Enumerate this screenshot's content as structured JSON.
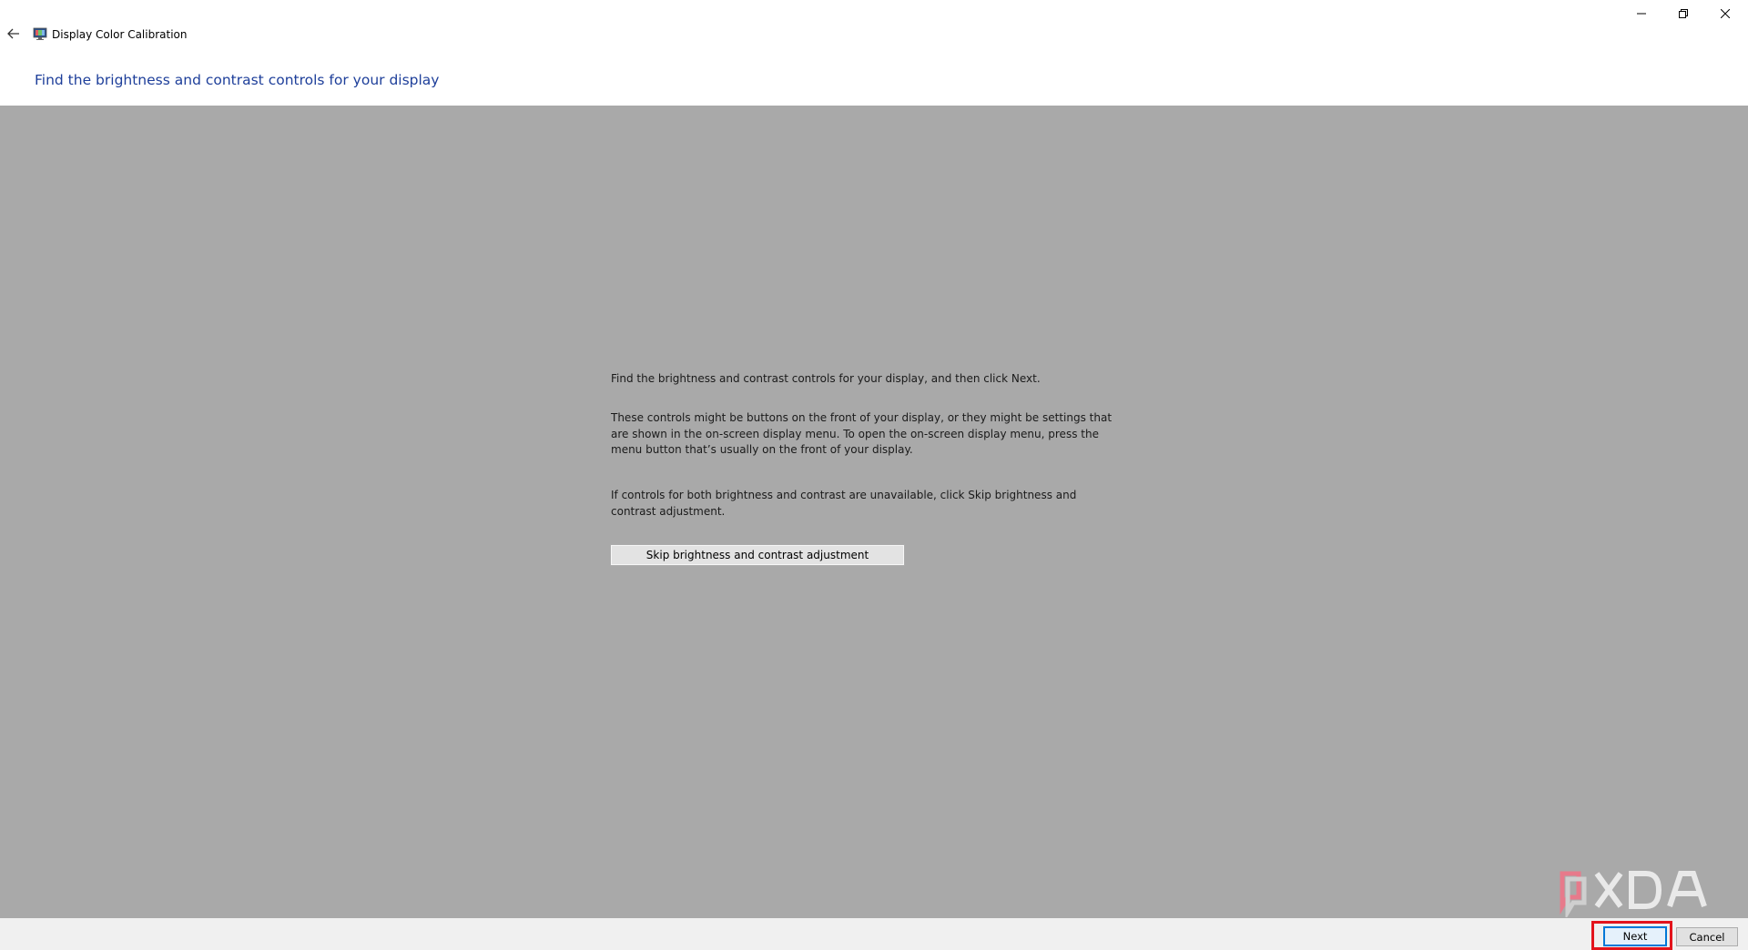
{
  "window": {
    "title": "Display Color Calibration",
    "icons": {
      "back": "back-arrow-icon",
      "app": "display-calibration-icon",
      "minimize": "minimize-icon",
      "maximize": "restore-icon",
      "close": "close-icon"
    }
  },
  "header": {
    "heading": "Find the brightness and contrast controls for your display"
  },
  "content": {
    "paragraph1": "Find the brightness and contrast controls for your display, and then click Next.",
    "paragraph2": "These controls might be buttons on the front of your display, or they might be settings that are shown in the on-screen display menu. To open the on-screen display menu, press the menu button that’s usually on the front of your display.",
    "paragraph3": "If controls for both brightness and contrast are unavailable, click Skip brightness and contrast adjustment.",
    "skip_button_label": "Skip brightness and contrast adjustment",
    "background_color": "#a9a9a9"
  },
  "footer": {
    "next_label": "Next",
    "cancel_label": "Cancel",
    "highlight_color": "#e3141c"
  },
  "watermark": {
    "text": "XDA"
  },
  "colors": {
    "heading": "#1e3f9a",
    "focus": "#0078d7"
  }
}
